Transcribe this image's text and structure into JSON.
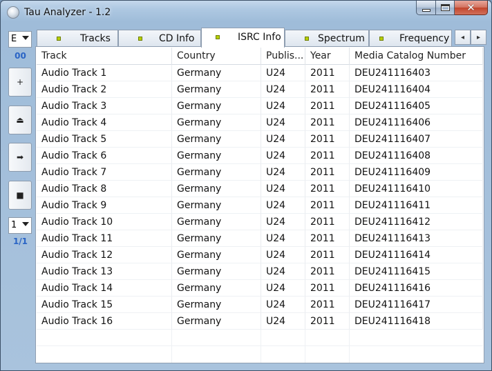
{
  "window": {
    "title": "Tau Analyzer - 1.2"
  },
  "sidebar": {
    "top_combo_value": "E",
    "top_label": "00",
    "bottom_combo_value": "1",
    "bottom_label": "1/1",
    "buttons": [
      {
        "icon": "plus-icon",
        "glyph": "+"
      },
      {
        "icon": "eject-icon",
        "glyph": "⏏"
      },
      {
        "icon": "play-icon",
        "glyph": "➡"
      },
      {
        "icon": "stop-icon",
        "glyph": "■"
      }
    ]
  },
  "tabs": [
    {
      "label": "Tracks",
      "active": false
    },
    {
      "label": "CD Info",
      "active": false
    },
    {
      "label": "ISRC Info",
      "active": true
    },
    {
      "label": "Spectrum",
      "active": false
    },
    {
      "label": "Frequency",
      "active": false
    }
  ],
  "table": {
    "columns": [
      "Track",
      "Country",
      "Publis...",
      "Year",
      "Media Catalog Number"
    ],
    "rows": [
      [
        "Audio Track 1",
        "Germany",
        "U24",
        "2011",
        "DEU241116403"
      ],
      [
        "Audio Track 2",
        "Germany",
        "U24",
        "2011",
        "DEU241116404"
      ],
      [
        "Audio Track 3",
        "Germany",
        "U24",
        "2011",
        "DEU241116405"
      ],
      [
        "Audio Track 4",
        "Germany",
        "U24",
        "2011",
        "DEU241116406"
      ],
      [
        "Audio Track 5",
        "Germany",
        "U24",
        "2011",
        "DEU241116407"
      ],
      [
        "Audio Track 6",
        "Germany",
        "U24",
        "2011",
        "DEU241116408"
      ],
      [
        "Audio Track 7",
        "Germany",
        "U24",
        "2011",
        "DEU241116409"
      ],
      [
        "Audio Track 8",
        "Germany",
        "U24",
        "2011",
        "DEU241116410"
      ],
      [
        "Audio Track 9",
        "Germany",
        "U24",
        "2011",
        "DEU241116411"
      ],
      [
        "Audio Track 10",
        "Germany",
        "U24",
        "2011",
        "DEU241116412"
      ],
      [
        "Audio Track 11",
        "Germany",
        "U24",
        "2011",
        "DEU241116413"
      ],
      [
        "Audio Track 12",
        "Germany",
        "U24",
        "2011",
        "DEU241116414"
      ],
      [
        "Audio Track 13",
        "Germany",
        "U24",
        "2011",
        "DEU241116415"
      ],
      [
        "Audio Track 14",
        "Germany",
        "U24",
        "2011",
        "DEU241116416"
      ],
      [
        "Audio Track 15",
        "Germany",
        "U24",
        "2011",
        "DEU241116417"
      ],
      [
        "Audio Track 16",
        "Germany",
        "U24",
        "2011",
        "DEU241116418"
      ]
    ]
  },
  "colors": {
    "tab_indicator": "#b8d000",
    "sidebar_label": "#2a64c5",
    "close_button": "#c2442c"
  }
}
